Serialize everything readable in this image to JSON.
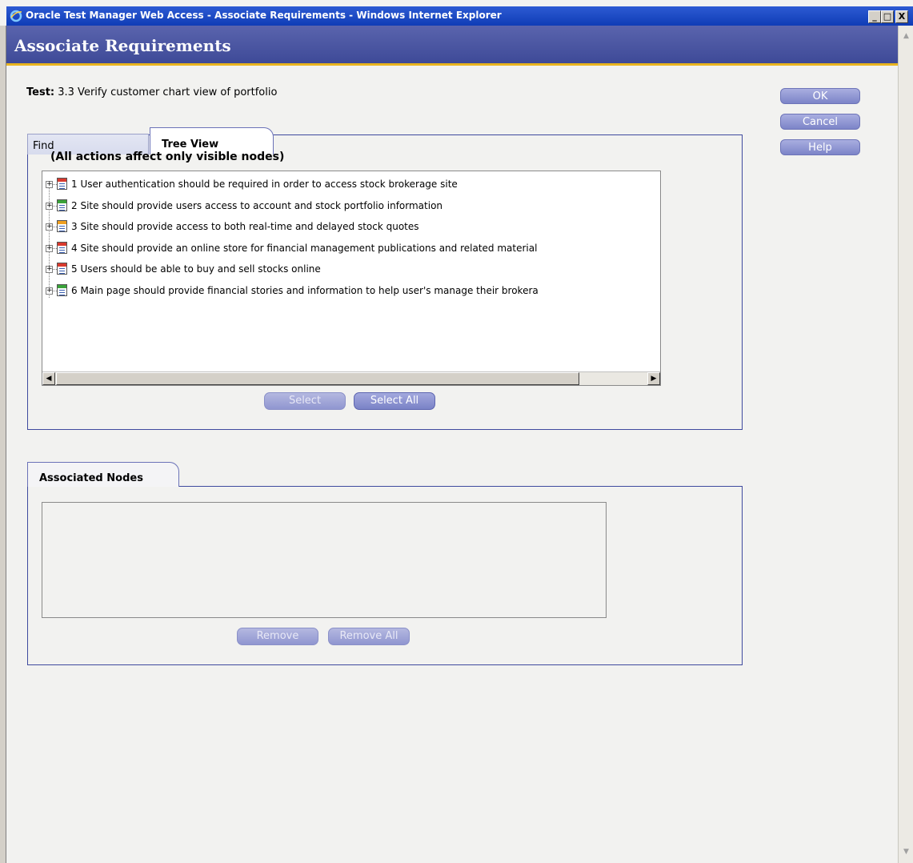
{
  "window": {
    "title": "Oracle Test Manager Web Access - Associate Requirements - Windows Internet Explorer",
    "controls": [
      "_",
      "□",
      "X"
    ]
  },
  "header": {
    "title": "Associate Requirements"
  },
  "test": {
    "label": "Test:",
    "value": "3.3 Verify customer chart view of portfolio"
  },
  "side_buttons": {
    "ok": "OK",
    "cancel": "Cancel",
    "help": "Help"
  },
  "tabs": {
    "find": "Find",
    "tree_view": "Tree View"
  },
  "tree": {
    "note": "(All actions affect only visible nodes)",
    "items": [
      {
        "text": "1 User authentication should be required in order to access stock brokerage site",
        "status_color": "#d83a2e"
      },
      {
        "text": "2 Site should provide users access to account and stock portfolio information",
        "status_color": "#3aa33a"
      },
      {
        "text": "3 Site should provide access to both real-time and delayed stock quotes",
        "status_color": "#f0a020"
      },
      {
        "text": "4 Site should provide an online store for financial management publications and related material",
        "status_color": "#d83a2e"
      },
      {
        "text": "5 Users should be able to buy and sell stocks online",
        "status_color": "#d83a2e"
      },
      {
        "text": "6 Main page should provide financial stories and information to help user's manage their brokera",
        "status_color": "#3aa33a"
      }
    ],
    "select_label": "Select",
    "select_all_label": "Select All"
  },
  "associated": {
    "tab_label": "Associated Nodes",
    "remove_label": "Remove",
    "remove_all_label": "Remove All"
  }
}
